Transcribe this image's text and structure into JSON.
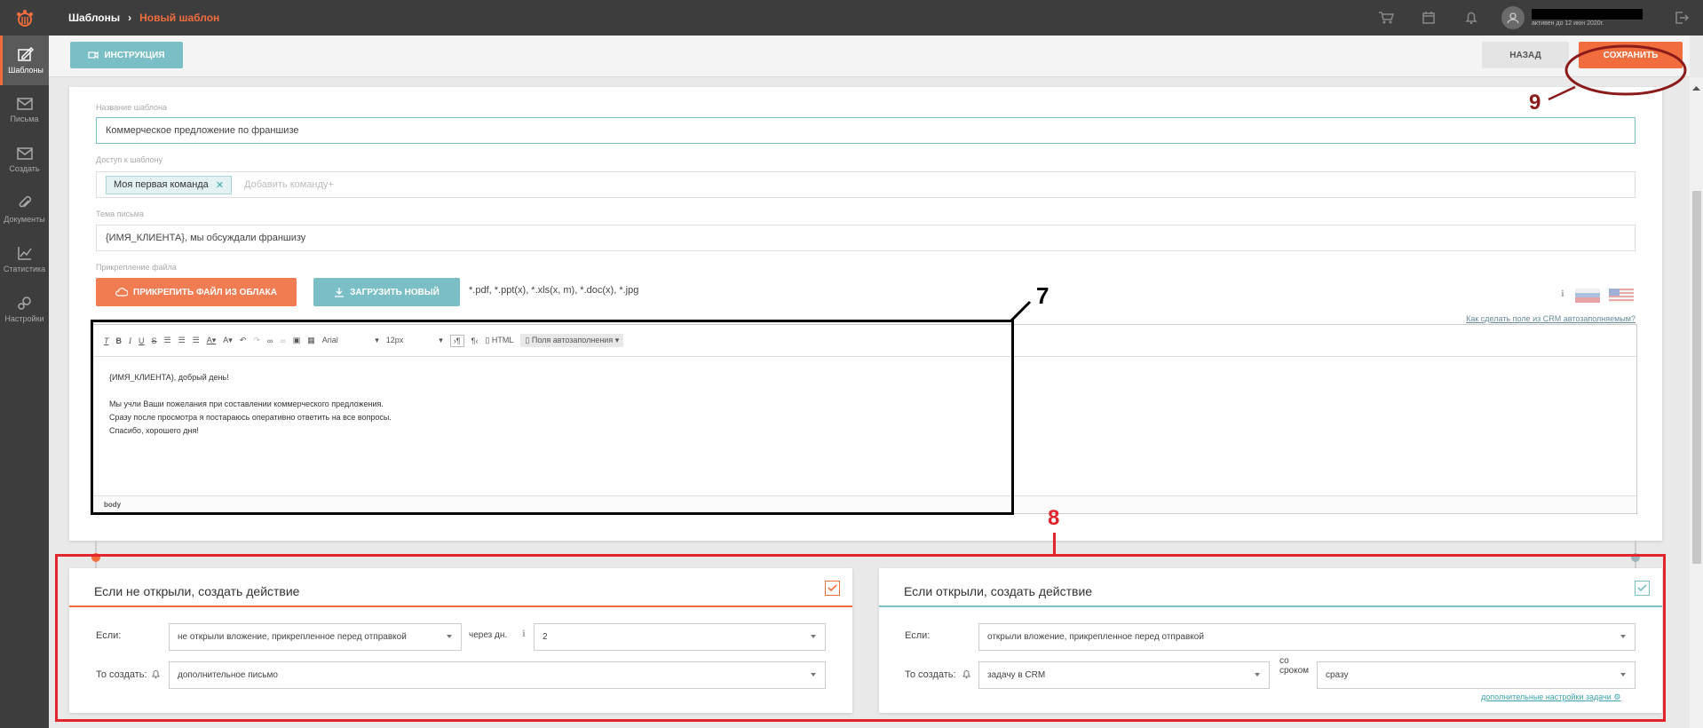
{
  "app": {
    "breadcrumb_root": "Шаблоны",
    "breadcrumb_current": "Новый шаблон",
    "user_sub": "активен до 12 июн 2020г.",
    "brand_color": "#f26d3d",
    "teal_color": "#7bbfc6"
  },
  "sidebar": {
    "items": [
      {
        "label": "Шаблоны",
        "icon": "templates-icon"
      },
      {
        "label": "Письма",
        "icon": "mail-icon"
      },
      {
        "label": "Создать",
        "icon": "create-mail-icon"
      },
      {
        "label": "Документы",
        "icon": "paperclip-icon"
      },
      {
        "label": "Статистика",
        "icon": "chart-icon"
      },
      {
        "label": "Настройки",
        "icon": "gears-icon"
      }
    ]
  },
  "toolbar": {
    "instructions": "ИНСТРУКЦИЯ",
    "back": "НАЗАД",
    "save": "СОХРАНИТЬ"
  },
  "form": {
    "name_label": "Название шаблона",
    "name_value": "Коммерческое предложение по франшизе",
    "access_label": "Доступ к шаблону",
    "access_chip": "Моя первая команда",
    "access_placeholder": "Добавить команду+",
    "subject_label": "Тема письма",
    "subject_value": "{ИМЯ_КЛИЕНТА}, мы обсуждали франшизу",
    "attach_label": "Прикрепление файла",
    "attach_cloud": "ПРИКРЕПИТЬ ФАЙЛ ИЗ ОБЛАКА",
    "attach_upload": "ЗАГРУЗИТЬ НОВЫЙ",
    "formats": "*.pdf, *.ppt(x), *.xls(x, m), *.doc(x), *.jpg",
    "crm_hint": "Как сделать поле из CRM автозаполняемым?"
  },
  "editor": {
    "font": "Arial",
    "size": "12px",
    "html": "HTML",
    "autofill": "Поля автозаполнения",
    "footer": "body",
    "lines": [
      "{ИМЯ_КЛИЕНТА}, добрый день!",
      "",
      "Мы учли Ваши пожелания при составлении коммерческого предложения.",
      "Сразу после просмотра я постараюсь оперативно ответить на все вопросы.",
      "Спасибо, хорошего дня!"
    ]
  },
  "rules": {
    "left": {
      "title": "Если не открыли, создать действие",
      "if_label": "Если:",
      "if_value": "не открыли вложение, прикрепленное перед отправкой",
      "after_label": "через дн.",
      "after_value": "2",
      "then_label": "То создать:",
      "then_value": "дополнительное письмо"
    },
    "right": {
      "title": "Если открыли, создать действие",
      "if_label": "Если:",
      "if_value": "открыли вложение, прикрепленное перед отправкой",
      "then_label": "То создать:",
      "then_value": "задачу в CRM",
      "term_label_1": "со",
      "term_label_2": "сроком",
      "term_value": "сразу",
      "extra_link": "дополнительные настройки задачи"
    }
  },
  "annotations": {
    "a7": "7",
    "a8": "8",
    "a9": "9"
  }
}
